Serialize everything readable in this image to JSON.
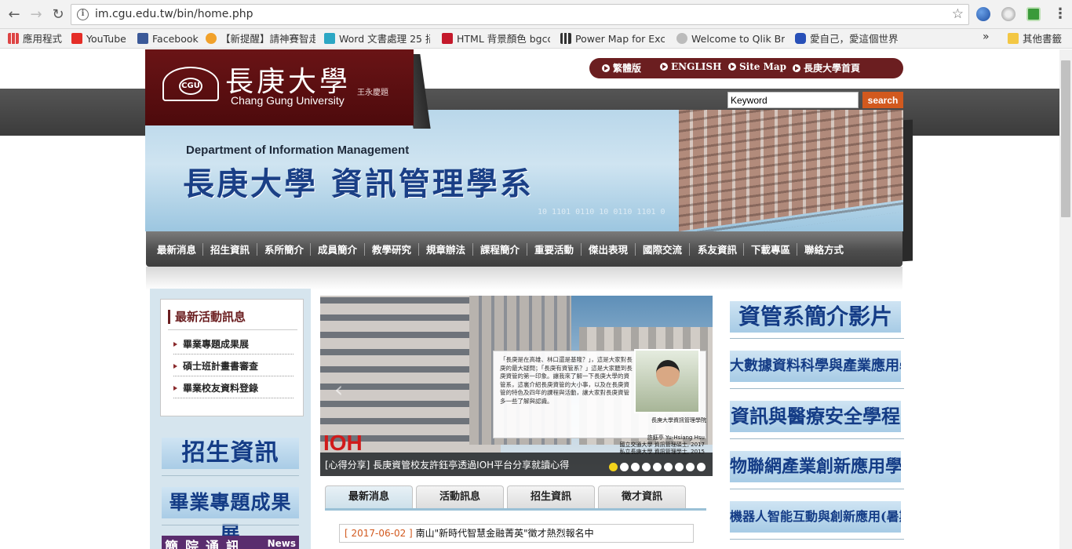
{
  "browser": {
    "url": "im.cgu.edu.tw/bin/home.php",
    "bookmarks": [
      {
        "label": "應用程式",
        "color": "#d44"
      },
      {
        "label": "YouTube",
        "color": "#e52d27"
      },
      {
        "label": "Facebook",
        "color": "#3b5998"
      },
      {
        "label": "【新提醒】請神賽智走",
        "color": "#f1a12a"
      },
      {
        "label": "Word 文書處理 25 招",
        "color": "#2ca7c4"
      },
      {
        "label": "HTML 背景顏色 bgco",
        "color": "#c4192b"
      },
      {
        "label": "Power Map for Excel",
        "color": "#333333"
      },
      {
        "label": "Welcome to Qlik Bra",
        "color": "#7a7a7a"
      },
      {
        "label": "愛自己，愛這個世界",
        "color": "#2850b8"
      }
    ],
    "other_bookmarks": "其他書籤",
    "more": "»"
  },
  "site": {
    "logo_cn": "長庚大學",
    "logo_en": "Chang Gung University",
    "logo_seal": "CGU",
    "logo_signature": "王永慶題",
    "toplinks": [
      "繁體版",
      "ENGLISH",
      "Site Map",
      "長庚大學首頁"
    ],
    "search_placeholder": "Keyword",
    "search_button": "search",
    "banner_en": "Department of Information Management",
    "banner_cn": "長庚大學  資訊管理學系",
    "nav": [
      "最新消息",
      "招生資訊",
      "系所簡介",
      "成員簡介",
      "教學研究",
      "規章辦法",
      "課程簡介",
      "重要活動",
      "傑出表現",
      "國際交流",
      "系友資訊",
      "下載專區",
      "聯絡方式"
    ]
  },
  "left": {
    "news_title": "最新活動訊息",
    "news_items": [
      "畢業專題成果展",
      "碩士班計畫書審查",
      "畢業校友資料登錄"
    ],
    "buttons": [
      "招生資訊",
      "畢業專題成果展"
    ],
    "news_banner": "簡院通訊",
    "news_banner_en": "News"
  },
  "slider": {
    "card_text": "「長庚是在高雄、林口還是基隆？」，這是大家對長庚的最大疑問；「長庚有資管系？」這是大家聽到長庚資管的第一印象。讓我來了解一下長庚大學的資管系，這裏介紹長庚資管的大小事，以及在長庚資管的特色及四年的課程與活動，讓大家對長庚資管多一些了解與認識。",
    "photo_caption": "長庚大學資訊管理學院",
    "person_caption": "許鈺亭 Yu-Hsiang Hsu\n國立交通大學 資訊管理碩士, 2017\n私立長庚大學 資訊管理學士, 2015",
    "logo_text": "IOH",
    "caption": "[心得分享] 長庚資管校友許鈺亭透過IOH平台分享就讀心得",
    "slide_count": 9,
    "active_slide": 1
  },
  "tabs": {
    "labels": [
      "最新消息",
      "活動訊息",
      "招生資訊",
      "徵才資訊"
    ],
    "active": 0,
    "items": [
      {
        "date": "[ 2017-06-02 ]",
        "title": "南山\"新時代智慧金融菁英\"徵才熱烈報名中"
      }
    ]
  },
  "right": {
    "buttons": [
      "資管系簡介影片",
      "大數據資料科學與產業應用學程",
      "資訊與醫療安全學程",
      "物聯網產業創新應用學程",
      "機器人智能互動與創新應用(暑期)學程"
    ]
  }
}
